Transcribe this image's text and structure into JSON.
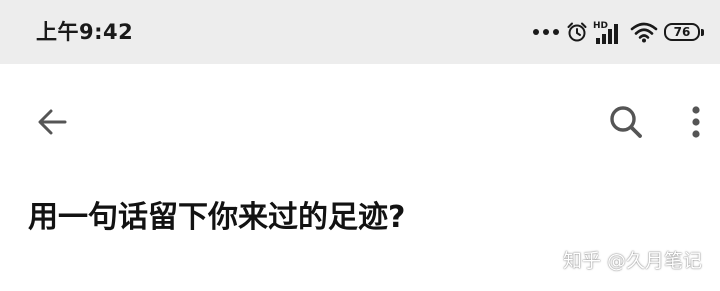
{
  "status_bar": {
    "time": "上午9:42",
    "network_label": "HD",
    "battery_level": "76",
    "icons": [
      "more-dots-icon",
      "alarm-icon",
      "signal-icon",
      "wifi-icon",
      "battery-icon"
    ]
  },
  "app_bar": {
    "icons": [
      "back-arrow-icon",
      "search-icon",
      "more-vertical-icon"
    ]
  },
  "question": {
    "title": "用一句话留下你来过的足迹?"
  },
  "watermark": {
    "text": "知乎 @久月笔记"
  },
  "colors": {
    "status_bar_bg": "#ededed",
    "page_bg": "#ffffff",
    "icon_gray": "#555555",
    "title_text": "#121212"
  }
}
